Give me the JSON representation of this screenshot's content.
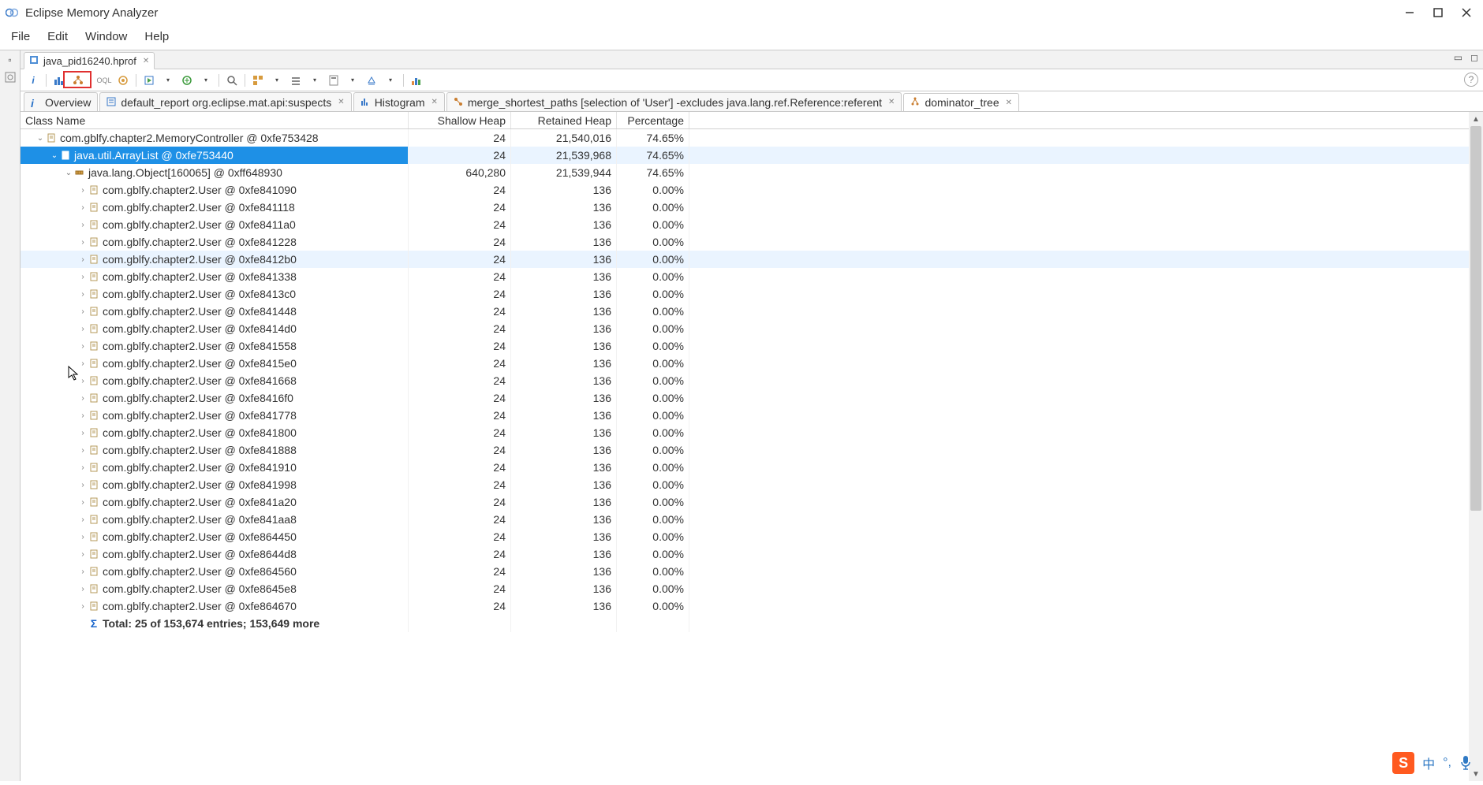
{
  "window": {
    "title": "Eclipse Memory Analyzer"
  },
  "menu": {
    "file": "File",
    "edit": "Edit",
    "window": "Window",
    "help": "Help"
  },
  "editor_tab": {
    "label": "java_pid16240.hprof"
  },
  "content_tabs": {
    "overview": "Overview",
    "default_report": "default_report  org.eclipse.mat.api:suspects",
    "histogram": "Histogram",
    "merge": "merge_shortest_paths [selection of 'User'] -excludes java.lang.ref.Reference:referent",
    "dominator": "dominator_tree"
  },
  "columns": {
    "name": "Class Name",
    "shallow": "Shallow Heap",
    "retained": "Retained Heap",
    "pct": "Percentage"
  },
  "rows": [
    {
      "indent": 0,
      "arrow": "down",
      "icon": "class",
      "name": "com.gblfy.chapter2.MemoryController @ 0xfe753428",
      "shallow": "24",
      "retained": "21,540,016",
      "pct": "74.65%",
      "state": ""
    },
    {
      "indent": 1,
      "arrow": "down",
      "icon": "class-sel",
      "name": "java.util.ArrayList @ 0xfe753440",
      "shallow": "24",
      "retained": "21,539,968",
      "pct": "74.65%",
      "state": "selected"
    },
    {
      "indent": 2,
      "arrow": "down",
      "icon": "array",
      "name": "java.lang.Object[160065] @ 0xff648930",
      "shallow": "640,280",
      "retained": "21,539,944",
      "pct": "74.65%",
      "state": ""
    },
    {
      "indent": 3,
      "arrow": "right",
      "icon": "class",
      "name": "com.gblfy.chapter2.User @ 0xfe841090",
      "shallow": "24",
      "retained": "136",
      "pct": "0.00%",
      "state": ""
    },
    {
      "indent": 3,
      "arrow": "right",
      "icon": "class",
      "name": "com.gblfy.chapter2.User @ 0xfe841118",
      "shallow": "24",
      "retained": "136",
      "pct": "0.00%",
      "state": ""
    },
    {
      "indent": 3,
      "arrow": "right",
      "icon": "class",
      "name": "com.gblfy.chapter2.User @ 0xfe8411a0",
      "shallow": "24",
      "retained": "136",
      "pct": "0.00%",
      "state": ""
    },
    {
      "indent": 3,
      "arrow": "right",
      "icon": "class",
      "name": "com.gblfy.chapter2.User @ 0xfe841228",
      "shallow": "24",
      "retained": "136",
      "pct": "0.00%",
      "state": ""
    },
    {
      "indent": 3,
      "arrow": "right",
      "icon": "class",
      "name": "com.gblfy.chapter2.User @ 0xfe8412b0",
      "shallow": "24",
      "retained": "136",
      "pct": "0.00%",
      "state": "hover"
    },
    {
      "indent": 3,
      "arrow": "right",
      "icon": "class",
      "name": "com.gblfy.chapter2.User @ 0xfe841338",
      "shallow": "24",
      "retained": "136",
      "pct": "0.00%",
      "state": ""
    },
    {
      "indent": 3,
      "arrow": "right",
      "icon": "class",
      "name": "com.gblfy.chapter2.User @ 0xfe8413c0",
      "shallow": "24",
      "retained": "136",
      "pct": "0.00%",
      "state": ""
    },
    {
      "indent": 3,
      "arrow": "right",
      "icon": "class",
      "name": "com.gblfy.chapter2.User @ 0xfe841448",
      "shallow": "24",
      "retained": "136",
      "pct": "0.00%",
      "state": ""
    },
    {
      "indent": 3,
      "arrow": "right",
      "icon": "class",
      "name": "com.gblfy.chapter2.User @ 0xfe8414d0",
      "shallow": "24",
      "retained": "136",
      "pct": "0.00%",
      "state": ""
    },
    {
      "indent": 3,
      "arrow": "right",
      "icon": "class",
      "name": "com.gblfy.chapter2.User @ 0xfe841558",
      "shallow": "24",
      "retained": "136",
      "pct": "0.00%",
      "state": ""
    },
    {
      "indent": 3,
      "arrow": "right",
      "icon": "class",
      "name": "com.gblfy.chapter2.User @ 0xfe8415e0",
      "shallow": "24",
      "retained": "136",
      "pct": "0.00%",
      "state": ""
    },
    {
      "indent": 3,
      "arrow": "right",
      "icon": "class",
      "name": "com.gblfy.chapter2.User @ 0xfe841668",
      "shallow": "24",
      "retained": "136",
      "pct": "0.00%",
      "state": ""
    },
    {
      "indent": 3,
      "arrow": "right",
      "icon": "class",
      "name": "com.gblfy.chapter2.User @ 0xfe8416f0",
      "shallow": "24",
      "retained": "136",
      "pct": "0.00%",
      "state": ""
    },
    {
      "indent": 3,
      "arrow": "right",
      "icon": "class",
      "name": "com.gblfy.chapter2.User @ 0xfe841778",
      "shallow": "24",
      "retained": "136",
      "pct": "0.00%",
      "state": ""
    },
    {
      "indent": 3,
      "arrow": "right",
      "icon": "class",
      "name": "com.gblfy.chapter2.User @ 0xfe841800",
      "shallow": "24",
      "retained": "136",
      "pct": "0.00%",
      "state": ""
    },
    {
      "indent": 3,
      "arrow": "right",
      "icon": "class",
      "name": "com.gblfy.chapter2.User @ 0xfe841888",
      "shallow": "24",
      "retained": "136",
      "pct": "0.00%",
      "state": ""
    },
    {
      "indent": 3,
      "arrow": "right",
      "icon": "class",
      "name": "com.gblfy.chapter2.User @ 0xfe841910",
      "shallow": "24",
      "retained": "136",
      "pct": "0.00%",
      "state": ""
    },
    {
      "indent": 3,
      "arrow": "right",
      "icon": "class",
      "name": "com.gblfy.chapter2.User @ 0xfe841998",
      "shallow": "24",
      "retained": "136",
      "pct": "0.00%",
      "state": ""
    },
    {
      "indent": 3,
      "arrow": "right",
      "icon": "class",
      "name": "com.gblfy.chapter2.User @ 0xfe841a20",
      "shallow": "24",
      "retained": "136",
      "pct": "0.00%",
      "state": ""
    },
    {
      "indent": 3,
      "arrow": "right",
      "icon": "class",
      "name": "com.gblfy.chapter2.User @ 0xfe841aa8",
      "shallow": "24",
      "retained": "136",
      "pct": "0.00%",
      "state": ""
    },
    {
      "indent": 3,
      "arrow": "right",
      "icon": "class",
      "name": "com.gblfy.chapter2.User @ 0xfe864450",
      "shallow": "24",
      "retained": "136",
      "pct": "0.00%",
      "state": ""
    },
    {
      "indent": 3,
      "arrow": "right",
      "icon": "class",
      "name": "com.gblfy.chapter2.User @ 0xfe8644d8",
      "shallow": "24",
      "retained": "136",
      "pct": "0.00%",
      "state": ""
    },
    {
      "indent": 3,
      "arrow": "right",
      "icon": "class",
      "name": "com.gblfy.chapter2.User @ 0xfe864560",
      "shallow": "24",
      "retained": "136",
      "pct": "0.00%",
      "state": ""
    },
    {
      "indent": 3,
      "arrow": "right",
      "icon": "class",
      "name": "com.gblfy.chapter2.User @ 0xfe8645e8",
      "shallow": "24",
      "retained": "136",
      "pct": "0.00%",
      "state": ""
    },
    {
      "indent": 3,
      "arrow": "right",
      "icon": "class",
      "name": "com.gblfy.chapter2.User @ 0xfe864670",
      "shallow": "24",
      "retained": "136",
      "pct": "0.00%",
      "state": ""
    }
  ],
  "summary": {
    "text": "Total: 25 of 153,674 entries; 153,649 more"
  },
  "overlay": {
    "s_char": "S",
    "cn": "中",
    "dots": "°,",
    "mic": "🎤"
  }
}
